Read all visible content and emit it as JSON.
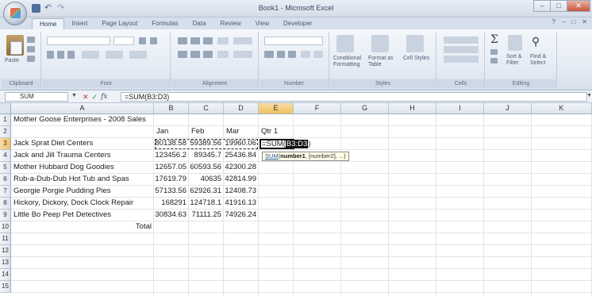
{
  "window": {
    "title": "Book1 - Microsoft Excel",
    "qat": {
      "save_icon": "save-icon",
      "undo_icon": "undo-icon",
      "redo_icon": "redo-icon"
    },
    "controls": {
      "minimize": "–",
      "maximize": "□",
      "close": "✕"
    }
  },
  "ribbon": {
    "tabs": [
      "Home",
      "Insert",
      "Page Layout",
      "Formulas",
      "Data",
      "Review",
      "View",
      "Developer"
    ],
    "active_tab": "Home",
    "right": [
      "?",
      "–",
      "□",
      "✕"
    ],
    "groups": {
      "clipboard": {
        "label": "Clipboard",
        "paste_label": "Paste"
      },
      "font": {
        "label": "Font"
      },
      "alignment": {
        "label": "Alignment"
      },
      "number": {
        "label": "Number"
      },
      "styles": {
        "label": "Styles",
        "conditional": "Conditional Formatting",
        "format_table": "Format as Table",
        "cell_styles": "Cell Styles"
      },
      "cells": {
        "label": "Cells"
      },
      "editing": {
        "label": "Editing",
        "sigma": "Σ",
        "sort": "Sort & Filter",
        "find": "Find & Select"
      }
    }
  },
  "formula_bar": {
    "name_box": "SUM",
    "cancel": "✕",
    "enter": "✓",
    "fx": "fx",
    "formula": "=SUM(B3:D3)"
  },
  "sheet": {
    "columns": [
      "A",
      "B",
      "C",
      "D",
      "E",
      "F",
      "G",
      "H",
      "I",
      "J",
      "K"
    ],
    "active_column": "E",
    "rows": [
      "1",
      "2",
      "3",
      "4",
      "5",
      "6",
      "7",
      "8",
      "9",
      "10",
      "11",
      "12",
      "13",
      "14",
      "15"
    ],
    "active_row": "3",
    "title_cell": "Mother Goose Enterprises - 2008 Sales",
    "headers": {
      "b": "Jan",
      "c": "Feb",
      "d": "Mar",
      "e": "Qtr 1"
    },
    "data": [
      {
        "name": "Jack Sprat Diet Centers",
        "jan": "80138.58",
        "feb": "59389.56",
        "mar": "19960.06"
      },
      {
        "name": "Jack and Jill Trauma Centers",
        "jan": "123456.2",
        "feb": "89345.7",
        "mar": "25436.84"
      },
      {
        "name": "Mother Hubbard Dog Goodies",
        "jan": "12657.05",
        "feb": "60593.56",
        "mar": "42300.28"
      },
      {
        "name": "Rub-a-Dub-Dub Hot Tub and Spas",
        "jan": "17619.79",
        "feb": "40635",
        "mar": "42814.99"
      },
      {
        "name": "Georgie Porgie Pudding Pies",
        "jan": "57133.56",
        "feb": "62926.31",
        "mar": "12408.73"
      },
      {
        "name": "Hickory, Dickory, Dock Clock Repair",
        "jan": "168291",
        "feb": "124718.1",
        "mar": "41916.13"
      },
      {
        "name": "Little Bo Peep Pet Detectives",
        "jan": "30834.63",
        "feb": "71111.25",
        "mar": "74926.24"
      }
    ],
    "total_label": "Total",
    "editing": {
      "prefix": "=SUM(",
      "ref": "B3:D3",
      "suffix": ")"
    },
    "tooltip": {
      "fn": "SUM",
      "arg1": "number1",
      "rest": ", [number2], ...)"
    }
  }
}
